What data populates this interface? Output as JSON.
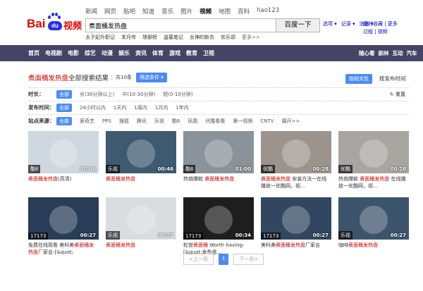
{
  "topnav": [
    "新闻",
    "网页",
    "贴吧",
    "知道",
    "音乐",
    "图片",
    "视频",
    "地图",
    "百科",
    "hao123"
  ],
  "topnav_active": 6,
  "logo": {
    "bai": "Bai",
    "du": "du",
    "video": "视频"
  },
  "search": {
    "value": "煮面桶发热盘",
    "button": "百度一下"
  },
  "hotwords": [
    "太子妃升职记",
    "芈月传",
    "琅琊榜",
    "盗墓笔记",
    "女神的新衣",
    "欢乐颂",
    "更多>>"
  ],
  "rightlinks": [
    "选项",
    "记录",
    "消息"
  ],
  "rightlinks2": [
    "我的收藏 | 更多",
    "过程 | 视频"
  ],
  "mainnav": {
    "items": [
      "首页",
      "电视剧",
      "电影",
      "综艺",
      "动漫",
      "娱乐",
      "资讯",
      "体育",
      "游戏",
      "教育",
      "卫视"
    ],
    "right": [
      "随心看",
      "剧林",
      "互动",
      "汽车"
    ]
  },
  "results": {
    "query": "煮面桶发热盘",
    "suffix": "全部搜索结果",
    "count": "：共10条",
    "filter_label": "筛选条件 ▾",
    "sort_hot": "按相关性",
    "sort_new": "按发布时间"
  },
  "filters": [
    {
      "label": "时长：",
      "options": [
        "全部",
        "长(30分钟以上)",
        "中(10-30分钟)",
        "短(0-10分钟)"
      ],
      "clear": "重置"
    },
    {
      "label": "发布时间：",
      "options": [
        "全部",
        "24小时以内",
        "1天内",
        "1周内",
        "1月内",
        "1年内"
      ]
    },
    {
      "label": "站点来源：",
      "options": [
        "全部",
        "爱奇艺",
        "PPS",
        "搜狐",
        "腾讯",
        "乐视",
        "酷6",
        "凤凰",
        "优酷看看",
        "第一视频",
        "CNTV",
        "展开>>"
      ]
    }
  ],
  "videos": [
    {
      "tag": "酷6",
      "duration": "00:46",
      "title_pre": "",
      "title_hl": "煮面桶发热盘",
      "title_post": "(高清)",
      "bg": "#cfd8df"
    },
    {
      "tag": "乐视",
      "duration": "00:46",
      "title_pre": "",
      "title_hl": "煮面桶发热盘",
      "title_post": "",
      "bg": "#3d5a70"
    },
    {
      "tag": "酷6",
      "duration": "01:00",
      "title_pre": "热销爆款 ",
      "title_hl": "煮面桶发热盘",
      "title_post": "",
      "bg": "#8a939a"
    },
    {
      "tag": "优酷",
      "duration": "00:28",
      "title_pre": "",
      "title_hl": "煮面桶发热盘",
      "title_post": " 安装方法一在线播放一优酷网，视...",
      "bg": "#9c948c"
    },
    {
      "tag": "优酷",
      "duration": "00:28",
      "title_pre": "热销爆款 ",
      "title_hl": "煮面桶发热盘",
      "title_post": " 在线播放一优酷网，视...",
      "bg": "#a9a6a1"
    },
    {
      "tag": "17173",
      "duration": "00:27",
      "title_pre": "免费在线观看 美科美",
      "title_hl": "煮面桶发热盘",
      "title_post": "厂家会-[&quot;",
      "bg": "#283d57"
    },
    {
      "tag": "乐视",
      "duration": "00:27",
      "title_pre": "",
      "title_hl": "煮面桶发热盘",
      "title_post": "",
      "bg": "#d9dde0"
    },
    {
      "tag": "17173",
      "duration": "00:34",
      "title_pre": "松宫",
      "title_hl": "煮面桶",
      "title_post": " Worth having-[&quot;发热盘...",
      "bg": "#1e1e1e"
    },
    {
      "tag": "17173",
      "duration": "00:27",
      "title_pre": "美科美",
      "title_hl": "煮面桶发热盘",
      "title_post": "厂家会",
      "bg": "#30475f"
    },
    {
      "tag": "乐视",
      "duration": "00:27",
      "title_pre": "咖啡",
      "title_hl": "煮面桶发热盘",
      "title_post": "",
      "bg": "#3c556c"
    }
  ],
  "pager": {
    "prev": "<上一页",
    "current": "1",
    "next": "下一页>"
  }
}
